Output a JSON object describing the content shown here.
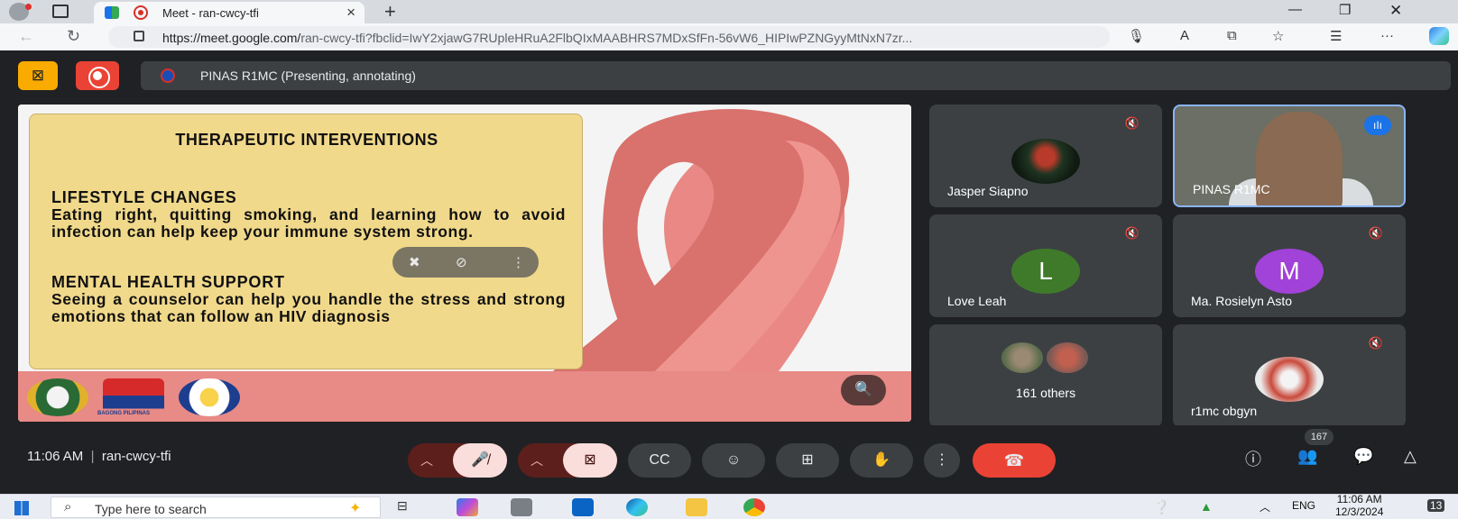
{
  "browser": {
    "tab_title": "Meet - ran-cwcy-tfi",
    "url_host": "https://meet.google.com/",
    "url_path": "ran-cwcy-tfi?fbclid=IwY2xjawG7RUpleHRuA2FlbQIxMAABHRS7MDxSfFn-56vW6_HIPIwPZNGyyMtNxN7zr...",
    "new_tab": "+",
    "close": "×"
  },
  "meet": {
    "presenting_label": "PINAS R1MC (Presenting, annotating)",
    "meeting_time": "11:06 AM",
    "meeting_code": "ran-cwcy-tfi",
    "separator": "|",
    "participant_count": "167"
  },
  "slide": {
    "heading": "THERAPEUTIC INTERVENTIONS",
    "section1_title": "LIFESTYLE CHANGES",
    "section1_body": "Eating right, quitting smoking, and learning how to avoid infection can help keep your immune system strong.",
    "section2_title": "MENTAL HEALTH SUPPORT",
    "section2_body": "Seeing a counselor can help you handle the stress and strong emotions that can follow an HIV diagnosis",
    "logo2_caption": "BAGONG PILIPINAS"
  },
  "tiles": [
    {
      "name": "Jasper Siapno",
      "muted": true
    },
    {
      "name": "PINAS R1MC",
      "muted": false
    },
    {
      "name": "Love Leah",
      "initial": "L",
      "muted": true,
      "color": "#3f7a2a"
    },
    {
      "name": "Ma. Rosielyn Asto",
      "initial": "M",
      "muted": true,
      "color": "#a142d8"
    },
    {
      "name": "161 others",
      "muted": false
    },
    {
      "name": "r1mc obgyn",
      "muted": true
    }
  ],
  "taskbar": {
    "search_placeholder": "Type here to search",
    "lang": "ENG",
    "time": "11:06 AM",
    "date": "12/3/2024",
    "notif": "13"
  },
  "colors": {
    "accent_yellow": "#f9ab00",
    "record_red": "#ea4335",
    "speaker_border": "#8ab4f8",
    "ribbon": "#e8827d",
    "slide_card": "#f1d98b"
  }
}
